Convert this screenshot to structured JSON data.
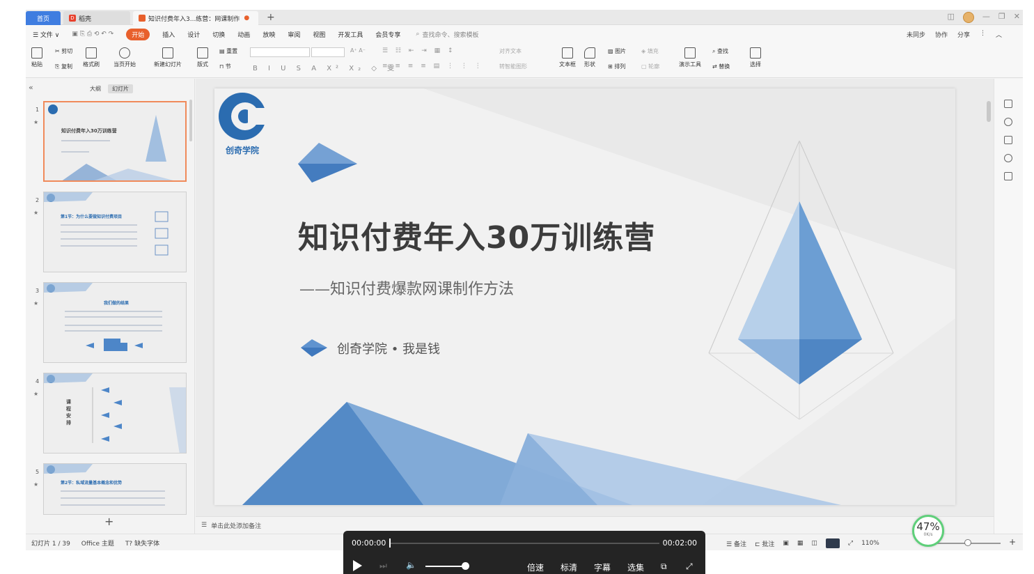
{
  "tabs": {
    "home": "首页",
    "daoke": "稻壳",
    "doc": "知识付费年入3...练营：网课制作"
  },
  "menu": {
    "items": [
      "☰ 文件 ∨",
      "开始",
      "插入",
      "设计",
      "切换",
      "动画",
      "放映",
      "审阅",
      "视图",
      "开发工具",
      "会员专享"
    ],
    "search": "查找命令、搜索模板",
    "right": [
      "未同步",
      "协作",
      "分享"
    ]
  },
  "ribbon": {
    "paste": "粘贴",
    "cut": "剪切",
    "copy": "复制",
    "format_painter": "格式刷",
    "start_from_current": "当页开始",
    "new_slide": "新建幻灯片",
    "layout": "版式",
    "section": "节",
    "reset": "重置",
    "text_box": "文本框",
    "shape": "形状",
    "picture": "图片",
    "arrange": "排列",
    "fill": "填充",
    "outline": "轮廓",
    "present_tools": "演示工具",
    "find": "查找",
    "replace": "替换",
    "select": "选择",
    "align_text": "对齐文本",
    "smart_art": "转智能图形"
  },
  "left_panel": {
    "tab_outline": "大纲",
    "tab_slides": "幻灯片",
    "slides": [
      {
        "num": "1",
        "title": "知识付费年入30万训练营"
      },
      {
        "num": "2",
        "title": "第1节：为什么要做知识付费项目"
      },
      {
        "num": "3",
        "title": "我们做的结果"
      },
      {
        "num": "4",
        "title": "课程安排"
      },
      {
        "num": "5",
        "title": "第2节：私域流量基本概念和优势"
      }
    ],
    "add": "+"
  },
  "slide": {
    "logo_text": "创奇学院",
    "title": "知识付费年入30万训练营",
    "subtitle": "——知识付费爆款网课制作方法",
    "author": "创奇学院 • 我是钱"
  },
  "notes": {
    "placeholder": "单击此处添加备注"
  },
  "status": {
    "slide_counter": "幻灯片 1 / 39",
    "theme": "Office 主题",
    "missing_font": "缺失字体",
    "notes": "备注",
    "comments": "批注",
    "zoom": "110%"
  },
  "badge": {
    "percent": "47%",
    "sub": "0K/s"
  },
  "player": {
    "current_time": "00:00:00",
    "total_time": "00:02:00",
    "speed": "倍速",
    "quality": "标清",
    "subtitles": "字幕",
    "episodes": "选集"
  },
  "colors": {
    "accent": "#e8602c",
    "brand_blue": "#2b6cb0",
    "badge_green": "#5fcf7a"
  }
}
